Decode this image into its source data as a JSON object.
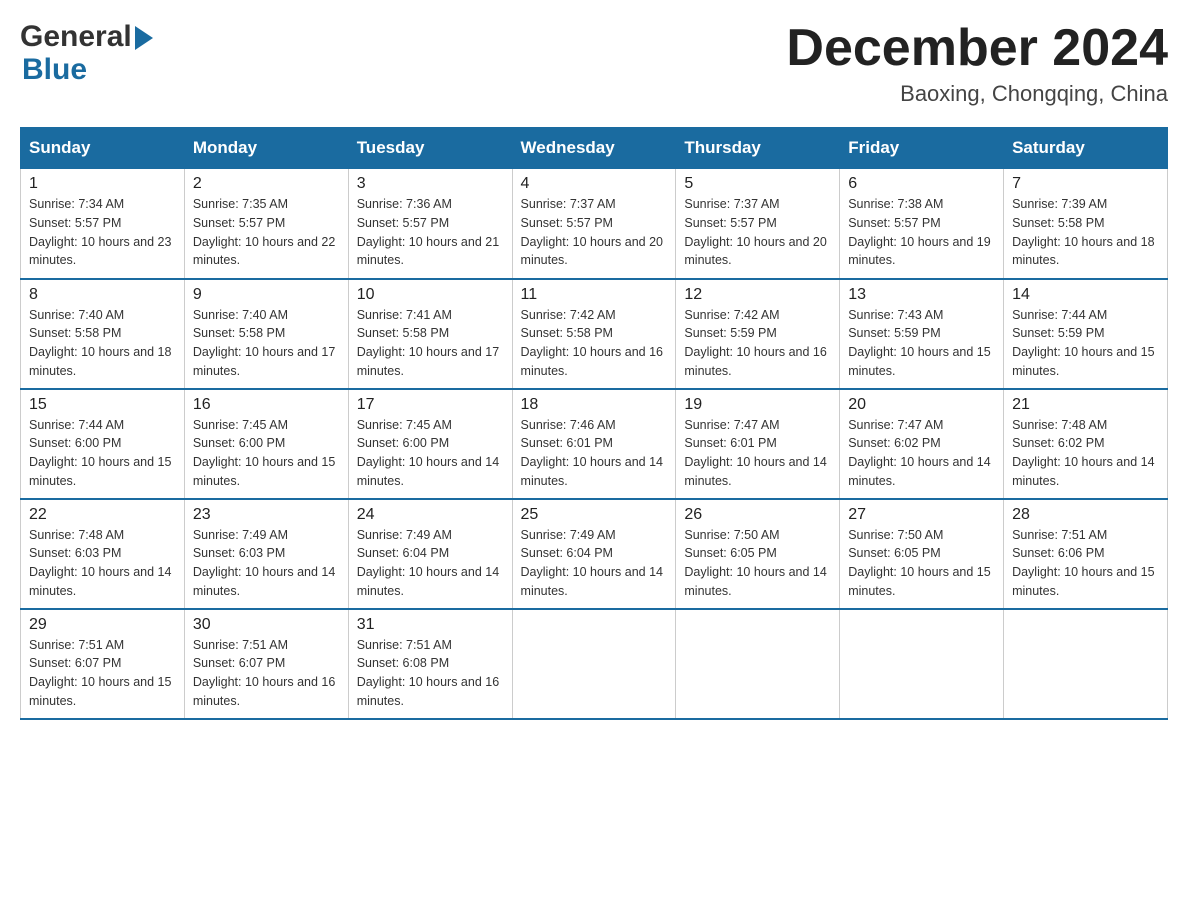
{
  "header": {
    "logo_general": "General",
    "logo_blue": "Blue",
    "month_title": "December 2024",
    "location": "Baoxing, Chongqing, China"
  },
  "days_of_week": [
    "Sunday",
    "Monday",
    "Tuesday",
    "Wednesday",
    "Thursday",
    "Friday",
    "Saturday"
  ],
  "weeks": [
    [
      {
        "day": "1",
        "sunrise": "7:34 AM",
        "sunset": "5:57 PM",
        "daylight": "10 hours and 23 minutes."
      },
      {
        "day": "2",
        "sunrise": "7:35 AM",
        "sunset": "5:57 PM",
        "daylight": "10 hours and 22 minutes."
      },
      {
        "day": "3",
        "sunrise": "7:36 AM",
        "sunset": "5:57 PM",
        "daylight": "10 hours and 21 minutes."
      },
      {
        "day": "4",
        "sunrise": "7:37 AM",
        "sunset": "5:57 PM",
        "daylight": "10 hours and 20 minutes."
      },
      {
        "day": "5",
        "sunrise": "7:37 AM",
        "sunset": "5:57 PM",
        "daylight": "10 hours and 20 minutes."
      },
      {
        "day": "6",
        "sunrise": "7:38 AM",
        "sunset": "5:57 PM",
        "daylight": "10 hours and 19 minutes."
      },
      {
        "day": "7",
        "sunrise": "7:39 AM",
        "sunset": "5:58 PM",
        "daylight": "10 hours and 18 minutes."
      }
    ],
    [
      {
        "day": "8",
        "sunrise": "7:40 AM",
        "sunset": "5:58 PM",
        "daylight": "10 hours and 18 minutes."
      },
      {
        "day": "9",
        "sunrise": "7:40 AM",
        "sunset": "5:58 PM",
        "daylight": "10 hours and 17 minutes."
      },
      {
        "day": "10",
        "sunrise": "7:41 AM",
        "sunset": "5:58 PM",
        "daylight": "10 hours and 17 minutes."
      },
      {
        "day": "11",
        "sunrise": "7:42 AM",
        "sunset": "5:58 PM",
        "daylight": "10 hours and 16 minutes."
      },
      {
        "day": "12",
        "sunrise": "7:42 AM",
        "sunset": "5:59 PM",
        "daylight": "10 hours and 16 minutes."
      },
      {
        "day": "13",
        "sunrise": "7:43 AM",
        "sunset": "5:59 PM",
        "daylight": "10 hours and 15 minutes."
      },
      {
        "day": "14",
        "sunrise": "7:44 AM",
        "sunset": "5:59 PM",
        "daylight": "10 hours and 15 minutes."
      }
    ],
    [
      {
        "day": "15",
        "sunrise": "7:44 AM",
        "sunset": "6:00 PM",
        "daylight": "10 hours and 15 minutes."
      },
      {
        "day": "16",
        "sunrise": "7:45 AM",
        "sunset": "6:00 PM",
        "daylight": "10 hours and 15 minutes."
      },
      {
        "day": "17",
        "sunrise": "7:45 AM",
        "sunset": "6:00 PM",
        "daylight": "10 hours and 14 minutes."
      },
      {
        "day": "18",
        "sunrise": "7:46 AM",
        "sunset": "6:01 PM",
        "daylight": "10 hours and 14 minutes."
      },
      {
        "day": "19",
        "sunrise": "7:47 AM",
        "sunset": "6:01 PM",
        "daylight": "10 hours and 14 minutes."
      },
      {
        "day": "20",
        "sunrise": "7:47 AM",
        "sunset": "6:02 PM",
        "daylight": "10 hours and 14 minutes."
      },
      {
        "day": "21",
        "sunrise": "7:48 AM",
        "sunset": "6:02 PM",
        "daylight": "10 hours and 14 minutes."
      }
    ],
    [
      {
        "day": "22",
        "sunrise": "7:48 AM",
        "sunset": "6:03 PM",
        "daylight": "10 hours and 14 minutes."
      },
      {
        "day": "23",
        "sunrise": "7:49 AM",
        "sunset": "6:03 PM",
        "daylight": "10 hours and 14 minutes."
      },
      {
        "day": "24",
        "sunrise": "7:49 AM",
        "sunset": "6:04 PM",
        "daylight": "10 hours and 14 minutes."
      },
      {
        "day": "25",
        "sunrise": "7:49 AM",
        "sunset": "6:04 PM",
        "daylight": "10 hours and 14 minutes."
      },
      {
        "day": "26",
        "sunrise": "7:50 AM",
        "sunset": "6:05 PM",
        "daylight": "10 hours and 14 minutes."
      },
      {
        "day": "27",
        "sunrise": "7:50 AM",
        "sunset": "6:05 PM",
        "daylight": "10 hours and 15 minutes."
      },
      {
        "day": "28",
        "sunrise": "7:51 AM",
        "sunset": "6:06 PM",
        "daylight": "10 hours and 15 minutes."
      }
    ],
    [
      {
        "day": "29",
        "sunrise": "7:51 AM",
        "sunset": "6:07 PM",
        "daylight": "10 hours and 15 minutes."
      },
      {
        "day": "30",
        "sunrise": "7:51 AM",
        "sunset": "6:07 PM",
        "daylight": "10 hours and 16 minutes."
      },
      {
        "day": "31",
        "sunrise": "7:51 AM",
        "sunset": "6:08 PM",
        "daylight": "10 hours and 16 minutes."
      },
      null,
      null,
      null,
      null
    ]
  ]
}
